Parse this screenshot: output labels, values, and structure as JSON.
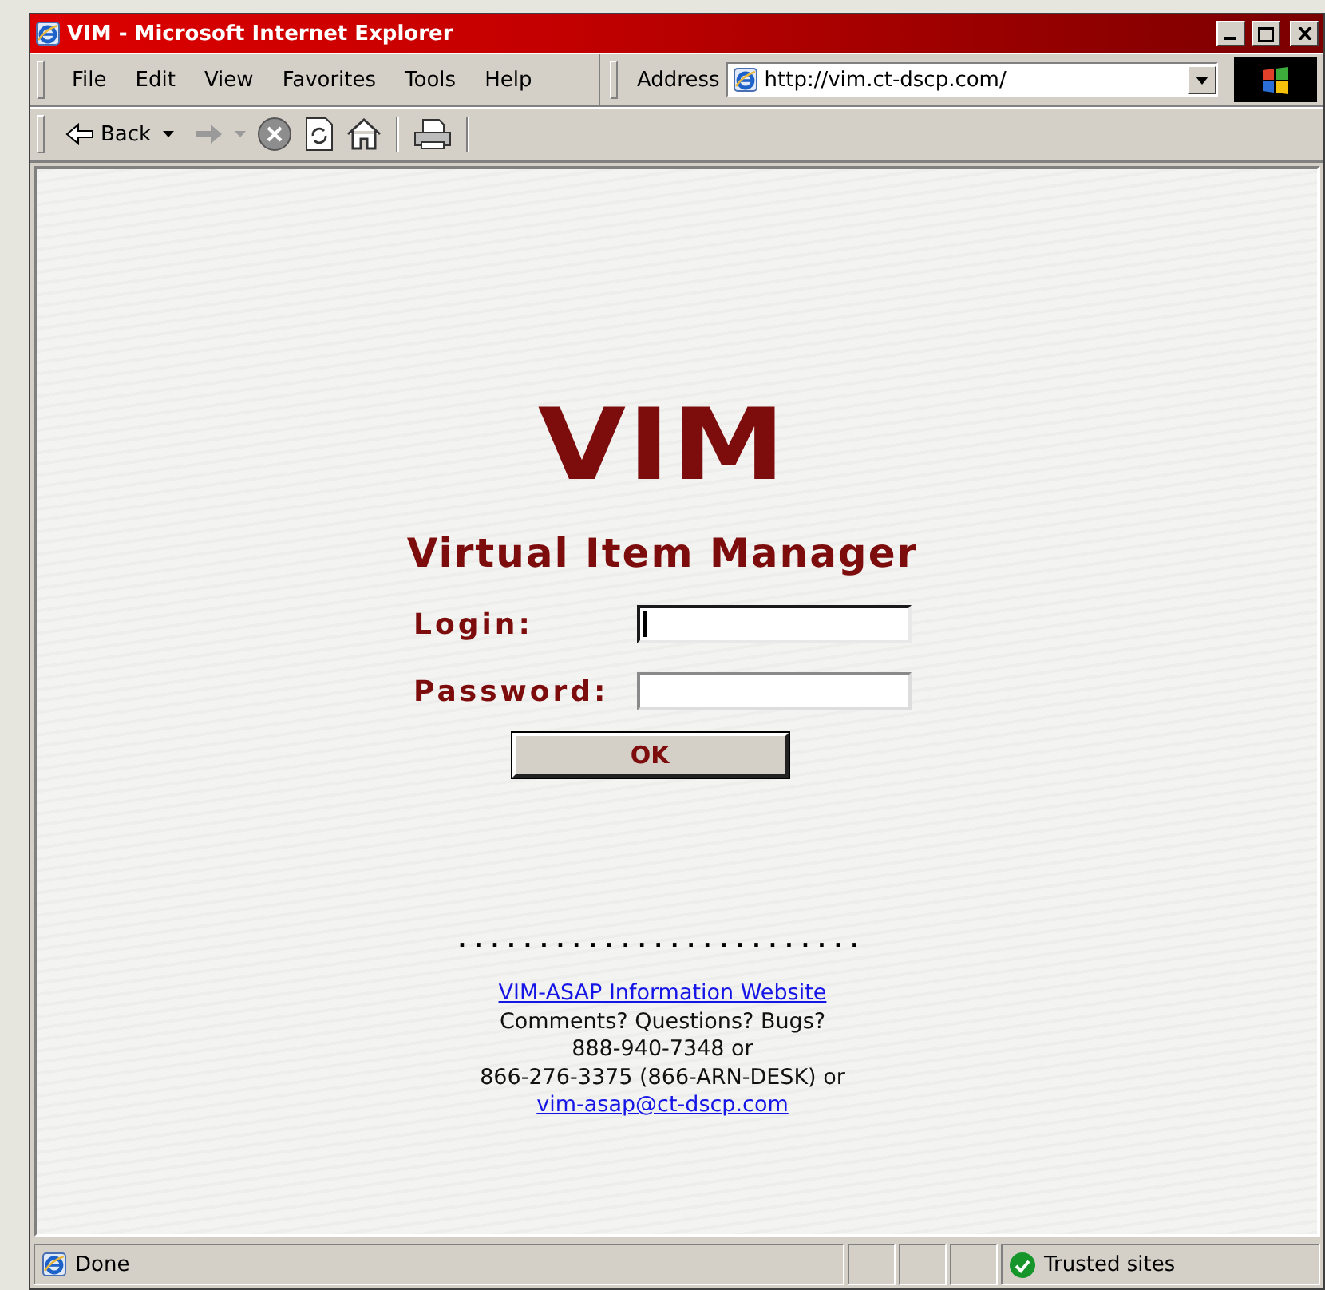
{
  "window": {
    "title": "VIM - Microsoft Internet Explorer"
  },
  "menu": [
    "File",
    "Edit",
    "View",
    "Favorites",
    "Tools",
    "Help"
  ],
  "address": {
    "label": "Address",
    "value": "http://vim.ct-dscp.com/"
  },
  "toolbar": {
    "back_label": "Back"
  },
  "page": {
    "logo": "VIM",
    "subtitle": "Virtual Item Manager",
    "fields": [
      {
        "label": "Login:",
        "focused": true
      },
      {
        "label": "Password:",
        "focused": false
      }
    ],
    "button": "OK",
    "divider": ".........................",
    "footer": [
      {
        "kind": "link",
        "text": "VIM-ASAP Information Website"
      },
      {
        "kind": "text",
        "text": "Comments? Questions? Bugs?"
      },
      {
        "kind": "text",
        "text": "888-940-7348 or"
      },
      {
        "kind": "text",
        "text": "866-276-3375 (866-ARN-DESK) or"
      },
      {
        "kind": "link",
        "text": "vim-asap@ct-dscp.com"
      }
    ]
  },
  "status_bar": {
    "text": "Done",
    "zone": "Trusted sites"
  }
}
